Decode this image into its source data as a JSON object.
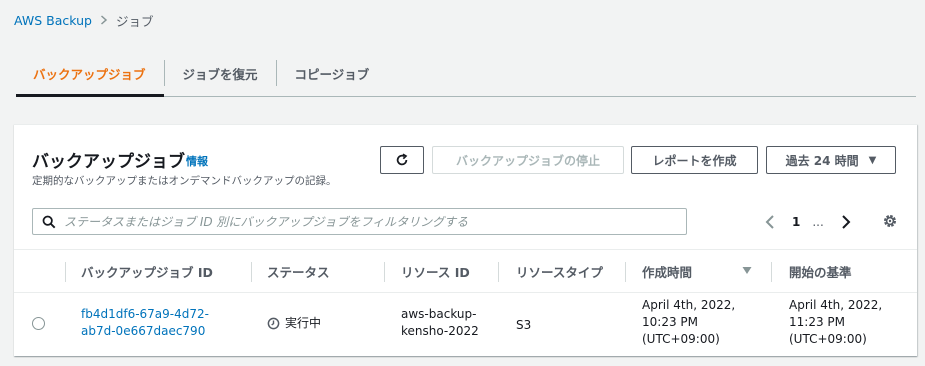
{
  "breadcrumb": {
    "root": "AWS Backup",
    "current": "ジョブ"
  },
  "tabs": [
    {
      "label": "バックアップジョブ"
    },
    {
      "label": "ジョブを復元"
    },
    {
      "label": "コピージョブ"
    }
  ],
  "panel": {
    "title": "バックアップジョブ",
    "info": "情報",
    "description": "定期的なバックアップまたはオンデマンドバックアップの記録。",
    "buttons": {
      "stop": "バックアップジョブの停止",
      "report": "レポートを作成",
      "range": "過去 24 時間"
    },
    "search_placeholder": "ステータスまたはジョブ ID 別にバックアップジョブをフィルタリングする",
    "pager": {
      "page": "1",
      "ellipsis": "..."
    }
  },
  "columns": [
    "バックアップジョブ ID",
    "ステータス",
    "リソース ID",
    "リソースタイプ",
    "作成時間",
    "開始の基準"
  ],
  "rows": [
    {
      "job_id_1": "fb4d1df6-67a9-4d72-",
      "job_id_2": "ab7d-0e667daec790",
      "status": "実行中",
      "resource_id_1": "aws-backup-",
      "resource_id_2": "kensho-2022",
      "resource_type": "S3",
      "created_1": "April 4th, 2022,",
      "created_2": "10:23 PM",
      "created_3": "(UTC+09:00)",
      "start_by_1": "April 4th, 2022,",
      "start_by_2": "11:23 PM",
      "start_by_3": "(UTC+09:00)"
    }
  ],
  "colors": {
    "accent": "#ec7211",
    "link": "#0073bb",
    "text": "#16191f",
    "muted": "#545b64"
  },
  "icons": [
    "chevron-right-icon",
    "refresh-icon",
    "caret-down-icon",
    "search-icon",
    "chevron-left-icon",
    "gear-icon",
    "sort-down-icon",
    "clock-icon"
  ]
}
